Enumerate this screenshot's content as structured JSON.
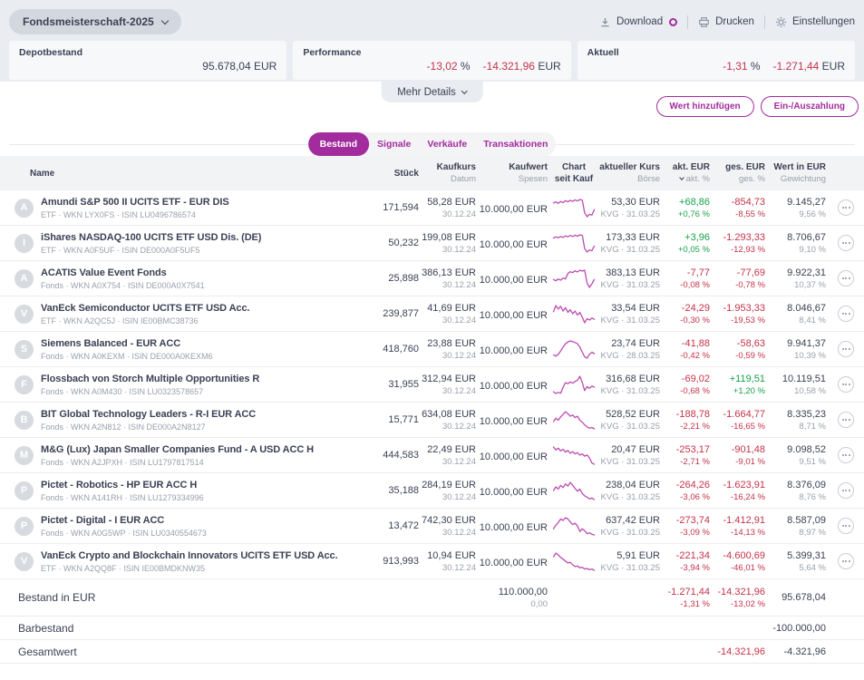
{
  "colors": {
    "accent": "#a22c9d",
    "negative": "#c5334a",
    "positive": "#18a14b",
    "spark": "#bd4bb0",
    "dark_text": "#3b4154",
    "gray_text": "#99a0ab"
  },
  "topbar": {
    "portfolio_name": "Fondsmeisterschaft-2025",
    "download_label": "Download",
    "print_label": "Drucken",
    "settings_label": "Einstellungen"
  },
  "summary": {
    "depot": {
      "label": "Depotbestand",
      "value": "95.678,04",
      "suffix": " EUR"
    },
    "performance": {
      "label": "Performance",
      "percent": "-13,02",
      "percent_suffix": " %",
      "amount": "-14.321,96",
      "amount_suffix": " EUR"
    },
    "aktuell": {
      "label": "Aktuell",
      "percent": "-1,31",
      "percent_suffix": " %",
      "amount": "-1.271,44",
      "amount_suffix": " EUR"
    }
  },
  "more_details_label": "Mehr Details",
  "actions": {
    "add_value": "Wert hinzufügen",
    "deposit": "Ein-/Auszahlung"
  },
  "tabs": [
    {
      "label": "Bestand",
      "active": true
    },
    {
      "label": "Signale",
      "active": false
    },
    {
      "label": "Verkäufe",
      "active": false
    },
    {
      "label": "Transaktionen",
      "active": false
    }
  ],
  "table": {
    "columns": {
      "name": "Name",
      "stueck": "Stück",
      "kaufkurs": "Kaufkurs",
      "kaufkurs_sub": "Datum",
      "kaufwert": "Kaufwert",
      "kaufwert_sub": "Spesen",
      "chart": "Chart",
      "chart_sub": "seit Kauf",
      "kurs": "aktueller Kurs",
      "kurs_sub": "Börse",
      "akt": "akt. EUR",
      "akt_sub": "akt. %",
      "ges": "ges. EUR",
      "ges_sub": "ges. %",
      "wert": "Wert in EUR",
      "wert_sub": "Gewichtung"
    },
    "rows": [
      {
        "letter": "A",
        "name": "Amundi S&P 500 II UCITS ETF - EUR DIS",
        "subtitle": "ETF · WKN LYX0FS · ISIN LU0496786574",
        "stueck": "171,594",
        "kaufkurs": "58,28 EUR",
        "kauf_datum": "30.12.24",
        "kaufwert": "10.000,00 EUR",
        "kurs": "53,30 EUR",
        "kurs_sub": "KVG · 31.03.25",
        "akt_eur": "+68,86",
        "akt_pct": "+0,76 %",
        "akt_dir": "pos",
        "ges_eur": "-854,73",
        "ges_pct": "-8,55 %",
        "ges_dir": "neg",
        "wert": "9.145,27",
        "gewichtung": "9,56 %",
        "spark": [
          55,
          58,
          54,
          59,
          56,
          61,
          58,
          62,
          59,
          63,
          60,
          64,
          62,
          30,
          20,
          26,
          24,
          38
        ]
      },
      {
        "letter": "I",
        "name": "iShares NASDAQ-100 UCITS ETF USD Dis. (DE)",
        "subtitle": "ETF · WKN A0F5UF · ISIN DE000A0F5UF5",
        "stueck": "50,232",
        "kaufkurs": "199,08 EUR",
        "kauf_datum": "30.12.24",
        "kaufwert": "10.000,00 EUR",
        "kurs": "173,33 EUR",
        "kurs_sub": "KVG · 31.03.25",
        "akt_eur": "+3,96",
        "akt_pct": "+0,05 %",
        "akt_dir": "pos",
        "ges_eur": "-1.293,33",
        "ges_pct": "-12,93 %",
        "ges_dir": "neg",
        "wert": "8.706,67",
        "gewichtung": "9,10 %",
        "spark": [
          58,
          62,
          59,
          63,
          60,
          65,
          62,
          66,
          63,
          67,
          64,
          68,
          66,
          26,
          16,
          22,
          20,
          34
        ]
      },
      {
        "letter": "A",
        "name": "ACATIS Value Event Fonds",
        "subtitle": "Fonds · WKN A0X754 · ISIN DE000A0X7541",
        "stueck": "25,898",
        "kaufkurs": "386,13 EUR",
        "kauf_datum": "30.12.24",
        "kaufwert": "10.000,00 EUR",
        "kurs": "383,13 EUR",
        "kurs_sub": "KVG · 31.03.25",
        "akt_eur": "-7,77",
        "akt_pct": "-0,08 %",
        "akt_dir": "neg",
        "ges_eur": "-77,69",
        "ges_pct": "-0,78 %",
        "ges_dir": "neg",
        "wert": "9.922,31",
        "gewichtung": "10,37 %",
        "spark": [
          40,
          36,
          42,
          38,
          45,
          42,
          60,
          66,
          63,
          69,
          65,
          71,
          68,
          71,
          28,
          14,
          26,
          40
        ]
      },
      {
        "letter": "V",
        "name": "VanEck Semiconductor UCITS ETF USD Acc.",
        "subtitle": "ETF · WKN A2QC5J · ISIN IE00BMC38736",
        "stueck": "239,877",
        "kaufkurs": "41,69 EUR",
        "kauf_datum": "30.12.24",
        "kaufwert": "10.000,00 EUR",
        "kurs": "33,54 EUR",
        "kurs_sub": "KVG · 31.03.25",
        "akt_eur": "-24,29",
        "akt_pct": "-0,30 %",
        "akt_dir": "neg",
        "ges_eur": "-1.953,33",
        "ges_pct": "-19,53 %",
        "ges_dir": "neg",
        "wert": "8.046,67",
        "gewichtung": "8,41 %",
        "spark": [
          48,
          66,
          56,
          64,
          50,
          60,
          46,
          54,
          42,
          50,
          38,
          46,
          32,
          16,
          28,
          24,
          30,
          26
        ]
      },
      {
        "letter": "S",
        "name": "Siemens Balanced - EUR ACC",
        "subtitle": "Fonds · WKN A0KEXM · ISIN DE000A0KEXM6",
        "stueck": "418,760",
        "kaufkurs": "23,88 EUR",
        "kauf_datum": "30.12.24",
        "kaufwert": "10.000,00 EUR",
        "kurs": "23,74 EUR",
        "kurs_sub": "KVG · 28.03.25",
        "akt_eur": "-41,88",
        "akt_pct": "-0,42 %",
        "akt_dir": "neg",
        "ges_eur": "-58,63",
        "ges_pct": "-0,59 %",
        "ges_dir": "neg",
        "wert": "9.941,37",
        "gewichtung": "10,39 %",
        "spark": [
          32,
          28,
          34,
          44,
          56,
          66,
          72,
          75,
          73,
          70,
          66,
          56,
          40,
          26,
          22,
          34,
          40,
          36
        ]
      },
      {
        "letter": "F",
        "name": "Flossbach von Storch Multiple Opportunities R",
        "subtitle": "Fonds · WKN A0M430 · ISIN LU0323578657",
        "stueck": "31,955",
        "kaufkurs": "312,94 EUR",
        "kauf_datum": "30.12.24",
        "kaufwert": "10.000,00 EUR",
        "kurs": "316,68 EUR",
        "kurs_sub": "KVG · 31.03.25",
        "akt_eur": "-69,02",
        "akt_pct": "-0,68 %",
        "akt_dir": "neg",
        "ges_eur": "+119,51",
        "ges_pct": "+1,20 %",
        "ges_dir": "pos",
        "wert": "10.119,51",
        "gewichtung": "10,58 %",
        "spark": [
          30,
          24,
          28,
          25,
          46,
          62,
          58,
          64,
          60,
          66,
          70,
          84,
          62,
          34,
          48,
          42,
          50,
          46
        ]
      },
      {
        "letter": "B",
        "name": "BIT Global Technology Leaders - R-I EUR ACC",
        "subtitle": "Fonds · WKN A2N812 · ISIN DE000A2N8127",
        "stueck": "15,771",
        "kaufkurs": "634,08 EUR",
        "kauf_datum": "30.12.24",
        "kaufwert": "10.000,00 EUR",
        "kurs": "528,52 EUR",
        "kurs_sub": "KVG · 31.03.25",
        "akt_eur": "-188,78",
        "akt_pct": "-2,21 %",
        "akt_dir": "neg",
        "ges_eur": "-1.664,77",
        "ges_pct": "-16,65 %",
        "ges_dir": "neg",
        "wert": "8.335,23",
        "gewichtung": "8,71 %",
        "spark": [
          44,
          54,
          48,
          58,
          66,
          74,
          68,
          60,
          64,
          56,
          60,
          48,
          42,
          34,
          28,
          24,
          26,
          22
        ]
      },
      {
        "letter": "M",
        "name": "M&G (Lux) Japan Smaller Companies Fund - A USD ACC H",
        "subtitle": "Fonds · WKN A2JPXH · ISIN LU1797817514",
        "stueck": "444,583",
        "kaufkurs": "22,49 EUR",
        "kauf_datum": "30.12.24",
        "kaufwert": "10.000,00 EUR",
        "kurs": "20,47 EUR",
        "kurs_sub": "KVG · 31.03.25",
        "akt_eur": "-253,17",
        "akt_pct": "-2,71 %",
        "akt_dir": "neg",
        "ges_eur": "-901,48",
        "ges_pct": "-9,01 %",
        "ges_dir": "neg",
        "wert": "9.098,52",
        "gewichtung": "9,51 %",
        "spark": [
          68,
          58,
          64,
          54,
          60,
          50,
          56,
          46,
          52,
          44,
          48,
          40,
          44,
          36,
          40,
          30,
          12,
          8
        ]
      },
      {
        "letter": "P",
        "name": "Pictet - Robotics - HP EUR ACC H",
        "subtitle": "Fonds · WKN A141RH · ISIN LU1279334996",
        "stueck": "35,188",
        "kaufkurs": "284,19 EUR",
        "kauf_datum": "30.12.24",
        "kaufwert": "10.000,00 EUR",
        "kurs": "238,04 EUR",
        "kurs_sub": "KVG · 31.03.25",
        "akt_eur": "-264,26",
        "akt_pct": "-3,06 %",
        "akt_dir": "neg",
        "ges_eur": "-1.623,91",
        "ges_pct": "-16,24 %",
        "ges_dir": "neg",
        "wert": "8.376,09",
        "gewichtung": "8,76 %",
        "spark": [
          52,
          62,
          56,
          66,
          60,
          70,
          64,
          74,
          66,
          58,
          50,
          56,
          44,
          38,
          34,
          30,
          32,
          28
        ]
      },
      {
        "letter": "P",
        "name": "Pictet - Digital - I EUR ACC",
        "subtitle": "Fonds · WKN A0G5WP · ISIN LU0340554673",
        "stueck": "13,472",
        "kaufkurs": "742,30 EUR",
        "kauf_datum": "30.12.24",
        "kaufwert": "10.000,00 EUR",
        "kurs": "637,42 EUR",
        "kurs_sub": "KVG · 31.03.25",
        "akt_eur": "-273,74",
        "akt_pct": "-3,09 %",
        "akt_dir": "neg",
        "ges_eur": "-1.412,91",
        "ges_pct": "-14,13 %",
        "ges_dir": "neg",
        "wert": "8.587,09",
        "gewichtung": "8,97 %",
        "spark": [
          42,
          52,
          60,
          70,
          66,
          74,
          70,
          62,
          54,
          58,
          50,
          34,
          42,
          36,
          28,
          30,
          26,
          24
        ]
      },
      {
        "letter": "V",
        "name": "VanEck Crypto and Blockchain Innovators UCITS ETF USD Acc.",
        "subtitle": "ETF · WKN A2QQ8F · ISIN IE00BMDKNW35",
        "stueck": "913,993",
        "kaufkurs": "10,94 EUR",
        "kauf_datum": "30.12.24",
        "kaufwert": "10.000,00 EUR",
        "kurs": "5,91 EUR",
        "kurs_sub": "KVG · 31.03.25",
        "akt_eur": "-221,34",
        "akt_pct": "-3,94 %",
        "akt_dir": "neg",
        "ges_eur": "-4.600,69",
        "ges_pct": "-46,01 %",
        "ges_dir": "neg",
        "wert": "5.399,31",
        "gewichtung": "5,64 %",
        "spark": [
          66,
          78,
          72,
          64,
          58,
          52,
          46,
          48,
          40,
          34,
          36,
          30,
          32,
          26,
          28,
          24,
          26,
          22
        ]
      }
    ],
    "footer": [
      {
        "label": "Bestand in EUR",
        "kaufwert": "110.000,00",
        "kaufwert_sub": "0,00",
        "akt": "-1.271,44",
        "akt_sub": "-1,31 %",
        "ges": "-14.321,96",
        "ges_sub": "-13,02 %",
        "wert": "95.678,04"
      },
      {
        "label": "Barbestand",
        "wert": "-100.000,00"
      },
      {
        "label": "Gesamtwert",
        "ges": "-14.321,96",
        "wert": "-4.321,96"
      }
    ]
  }
}
